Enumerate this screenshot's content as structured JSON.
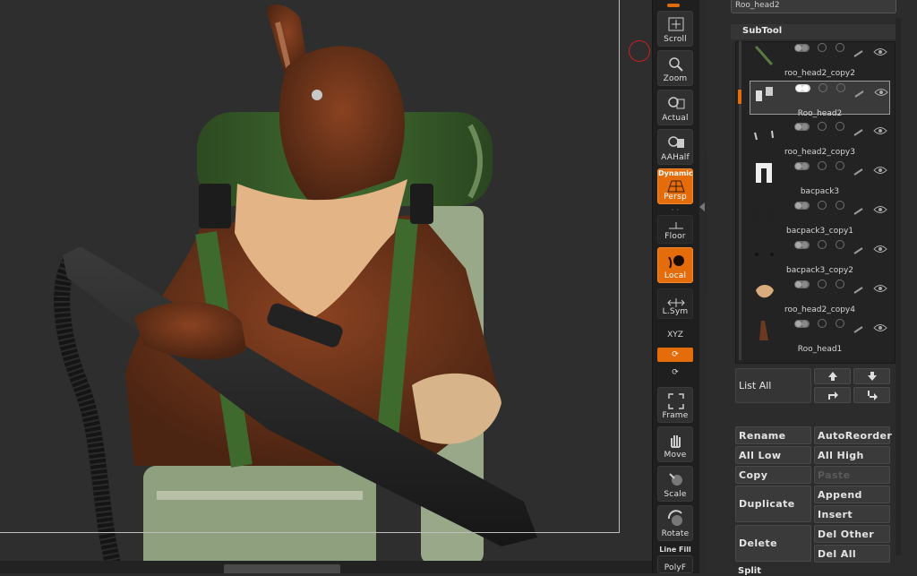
{
  "shelf": {
    "buttons": [
      {
        "key": "scroll",
        "label": "Scroll",
        "active": false
      },
      {
        "key": "zoom",
        "label": "Zoom",
        "active": false
      },
      {
        "key": "actual",
        "label": "Actual",
        "active": false
      },
      {
        "key": "aahalf",
        "label": "AAHalf",
        "active": false
      },
      {
        "key": "persp",
        "label": "Persp",
        "active": true,
        "top_label": "Dynamic"
      },
      {
        "key": "floor",
        "label": "Floor",
        "active": false
      },
      {
        "key": "local",
        "label": "Local",
        "active": true
      },
      {
        "key": "lsym",
        "label": "L.Sym",
        "active": false
      },
      {
        "key": "frame",
        "label": "Frame",
        "active": false
      },
      {
        "key": "move",
        "label": "Move",
        "active": false
      },
      {
        "key": "scale",
        "label": "Scale",
        "active": false
      },
      {
        "key": "rotate",
        "label": "Rotate",
        "active": false
      }
    ],
    "xyz_label": "XYZ",
    "linefill_label": "Line Fill",
    "polyf_label": "PolyF"
  },
  "palette": {
    "top_item": "Roo_head2",
    "subtool_title": "SubTool",
    "subtools": [
      {
        "name": "roo_head2_copy2",
        "selected": false
      },
      {
        "name": "Roo_head2",
        "selected": true
      },
      {
        "name": "roo_head2_copy3",
        "selected": false
      },
      {
        "name": "bacpack3",
        "selected": false
      },
      {
        "name": "bacpack3_copy1",
        "selected": false
      },
      {
        "name": "bacpack3_copy2",
        "selected": false
      },
      {
        "name": "roo_head2_copy4",
        "selected": false
      },
      {
        "name": "Roo_head1",
        "selected": false
      }
    ],
    "list_all": "List All",
    "actions": {
      "rename": "Rename",
      "autoreorder": "AutoReorder",
      "all_low": "All Low",
      "all_high": "All High",
      "copy": "Copy",
      "paste": "Paste",
      "duplicate": "Duplicate",
      "append": "Append",
      "insert": "Insert",
      "delete": "Delete",
      "del_other": "Del Other",
      "del_all": "Del All",
      "split": "Split"
    }
  },
  "colors": {
    "accent": "#e46c0a",
    "panel": "#2c2c2c",
    "shelf": "#1f1f1f"
  }
}
